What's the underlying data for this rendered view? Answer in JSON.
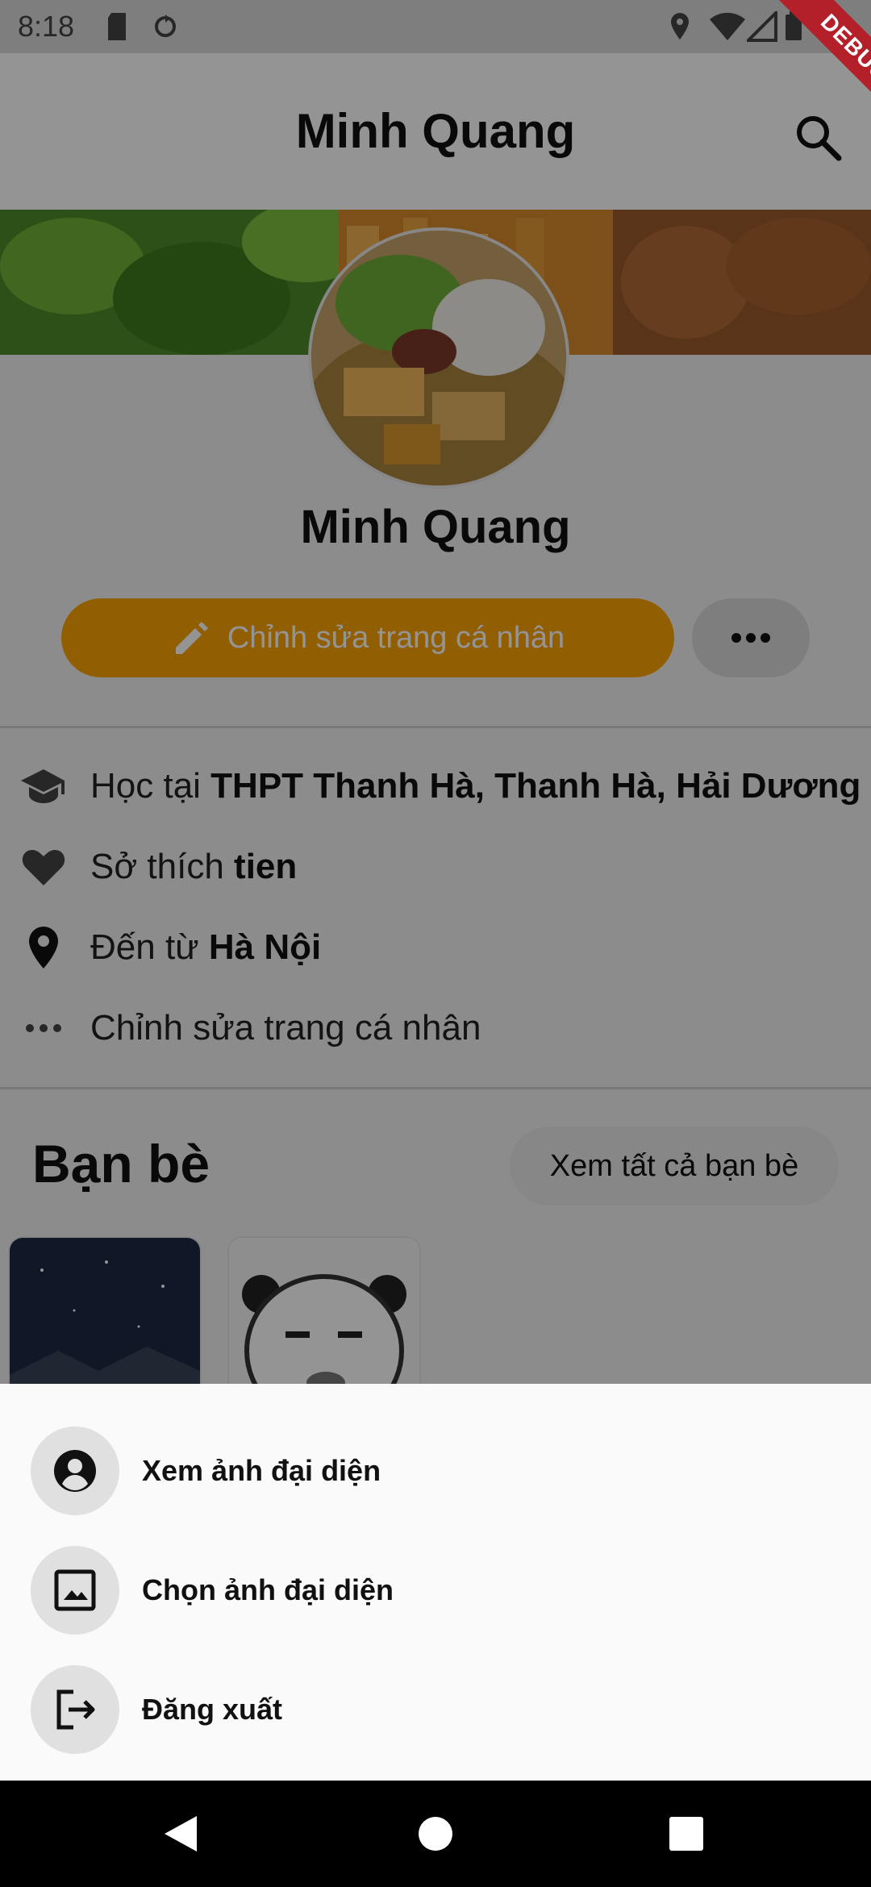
{
  "status_bar": {
    "time": "8:18",
    "icons": [
      "sd-card-icon",
      "sync-icon",
      "location-icon",
      "wifi-icon",
      "signal-icon",
      "battery-icon"
    ]
  },
  "debug_banner": "DEBUG",
  "app_bar": {
    "title": "Minh Quang",
    "search_icon": "search-icon"
  },
  "profile": {
    "name": "Minh Quang",
    "edit_button_label": "Chỉnh sửa trang cá nhân",
    "more_icon": "more-horizontal-icon"
  },
  "info": [
    {
      "icon": "school-icon",
      "prefix": "Học tại ",
      "value": "THPT Thanh Hà, Thanh Hà, Hải Dương"
    },
    {
      "icon": "heart-icon",
      "prefix": "Sở thích ",
      "value": "tien"
    },
    {
      "icon": "location-pin-icon",
      "prefix": "Đến từ ",
      "value": "Hà Nội"
    },
    {
      "icon": "more-horizontal-icon",
      "prefix": "Chỉnh sửa trang cá nhân",
      "value": ""
    }
  ],
  "friends": {
    "title": "Bạn bè",
    "see_all_label": "Xem tất cả bạn bè"
  },
  "bottom_sheet": {
    "items": [
      {
        "icon": "account-circle-icon",
        "label": "Xem ảnh đại diện"
      },
      {
        "icon": "image-icon",
        "label": "Chọn ảnh đại diện"
      },
      {
        "icon": "logout-icon",
        "label": "Đăng xuất"
      }
    ]
  },
  "colors": {
    "accent": "#fca205",
    "scrim": "rgba(0,0,0,0.42)",
    "debug": "#b3202a"
  }
}
